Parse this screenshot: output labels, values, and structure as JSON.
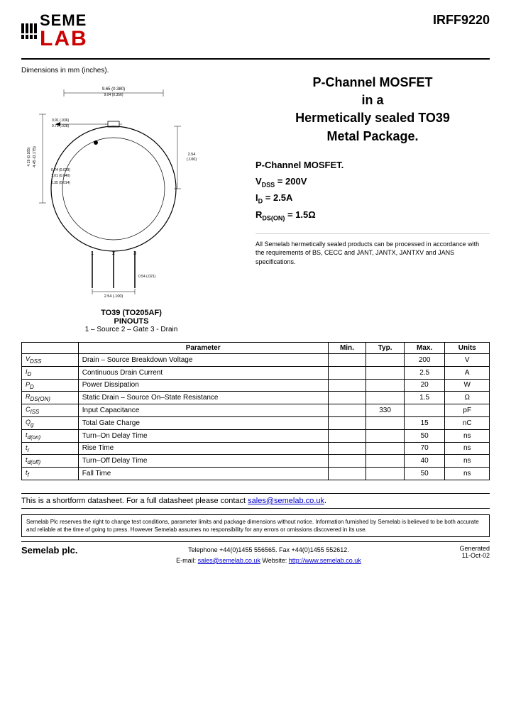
{
  "header": {
    "part_number": "IRFF9220",
    "logo_seme": "SEME",
    "logo_lab": "LAB"
  },
  "product": {
    "title_line1": "P-Channel MOSFET",
    "title_line2": "in a",
    "title_line3": "Hermetically sealed TO39",
    "title_line4": "Metal Package.",
    "subtitle": "P-Channel MOSFET.",
    "vdss": "V",
    "vdss_label": "DSS",
    "vdss_value": "= 200V",
    "id_label": "D",
    "id_value": "= 2.5A",
    "rds_value": "= 1.5Ω",
    "rds_label": "DS(ON)",
    "hermetic_note": "All Semelab hermetically sealed products can be processed in accordance with the requirements of BS, CECC and JANT, JANTX, JANTXV and JANS specifications."
  },
  "diagram": {
    "dimensions_label": "Dimensions in mm (inches).",
    "package_label": "TO39 (TO205AF)",
    "pinouts_title": "PINOUTS",
    "pinouts": "1 – Source      2 – Gate      3 - Drain"
  },
  "table": {
    "headers": [
      "",
      "Parameter",
      "Min.",
      "Typ.",
      "Max.",
      "Units"
    ],
    "rows": [
      {
        "symbol": "Vᴅₛₛ",
        "symbol_html": "V<sub>DSS</sub>",
        "parameter": "Drain – Source Breakdown Voltage",
        "min": "",
        "typ": "",
        "max": "200",
        "units": "V"
      },
      {
        "symbol": "Iᴅ",
        "symbol_html": "I<sub>D</sub>",
        "parameter": "Continuous Drain Current",
        "min": "",
        "typ": "",
        "max": "2.5",
        "units": "A"
      },
      {
        "symbol": "Pᴅ",
        "symbol_html": "P<sub>D</sub>",
        "parameter": "Power Dissipation",
        "min": "",
        "typ": "",
        "max": "20",
        "units": "W"
      },
      {
        "symbol": "Rᴅₛ(ᴏᴇ)",
        "symbol_html": "R<sub>DS(ON)</sub>",
        "parameter": "Static Drain – Source On–State Resistance",
        "min": "",
        "typ": "",
        "max": "1.5",
        "units": "Ω"
      },
      {
        "symbol": "Cᴵₛₛ",
        "symbol_html": "C<sub>ISS</sub>",
        "parameter": "Input Capacitance",
        "min": "",
        "typ": "330",
        "max": "",
        "units": "pF"
      },
      {
        "symbol": "Qᴳ",
        "symbol_html": "Q<sub>g</sub>",
        "parameter": "Total Gate Charge",
        "min": "",
        "typ": "",
        "max": "15",
        "units": "nC"
      },
      {
        "symbol": "tᴰ(ᴏᴇ)",
        "symbol_html": "t<sub>d(on)</sub>",
        "parameter": "Turn–On Delay Time",
        "min": "",
        "typ": "",
        "max": "50",
        "units": "ns"
      },
      {
        "symbol": "tᴿ",
        "symbol_html": "t<sub>r</sub>",
        "parameter": "Rise Time",
        "min": "",
        "typ": "",
        "max": "70",
        "units": "ns"
      },
      {
        "symbol": "tᴰ(ᴏᴛᴛ)",
        "symbol_html": "t<sub>d(off)</sub>",
        "parameter": "Turn–Off Delay Time",
        "min": "",
        "typ": "",
        "max": "40",
        "units": "ns"
      },
      {
        "symbol": "tᴾ",
        "symbol_html": "t<sub>f</sub>",
        "parameter": "Fall Time",
        "min": "",
        "typ": "",
        "max": "50",
        "units": "ns"
      }
    ]
  },
  "footer": {
    "shortform_text": "This is a shortform datasheet. For a full datasheet please contact ",
    "shortform_email": "sales@semelab.co.uk",
    "shortform_email_href": "mailto:sales@semelab.co.uk",
    "disclaimer": "Semelab Plc reserves the right to change test conditions, parameter limits and package dimensions without notice. Information furnished by Semelab is believed to be both accurate and reliable at the time of going to press. However Semelab assumes no responsibility for any errors or omissions discovered in its use.",
    "company": "Semelab plc.",
    "telephone": "Telephone +44(0)1455 556565.  Fax +44(0)1455 552612.",
    "email_label": "E-mail: ",
    "email": "sales@semelab.co.uk",
    "website_label": "  Website: ",
    "website": "http://www.semelab.co.uk",
    "generated_label": "Generated",
    "generated_date": "11-Oct-02"
  }
}
